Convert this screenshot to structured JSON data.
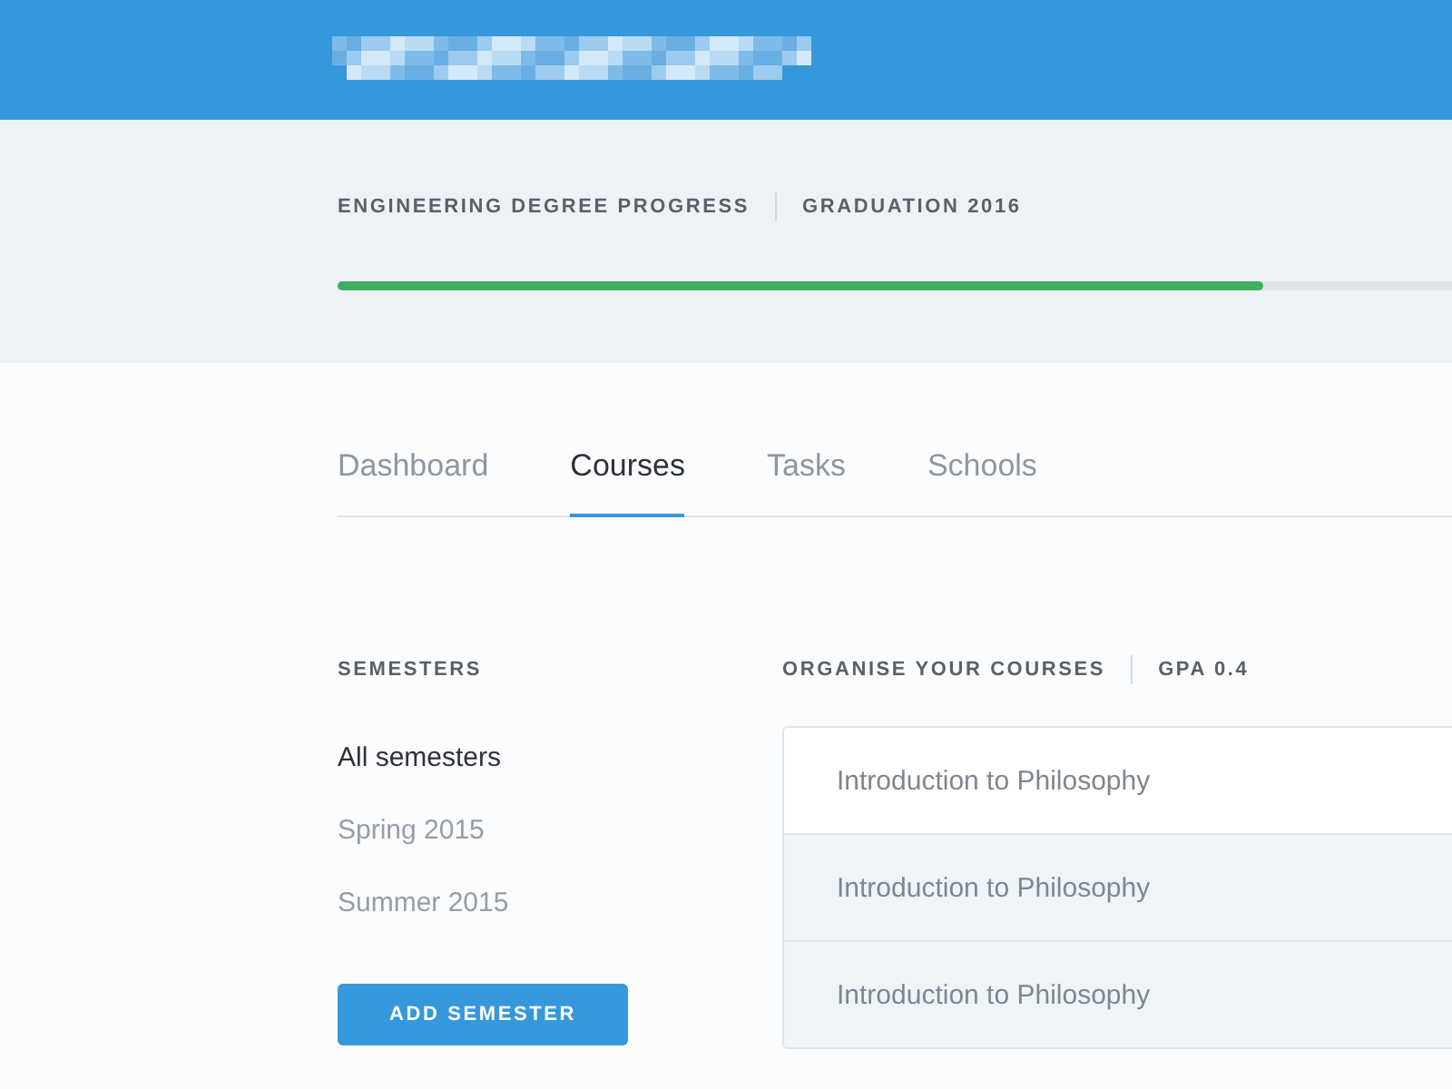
{
  "progress": {
    "title": "ENGINEERING DEGREE PROGRESS",
    "graduation": "GRADUATION 2016",
    "level": 0.83
  },
  "tabs": [
    {
      "label": "Dashboard",
      "selected": false
    },
    {
      "label": "Courses",
      "selected": true
    },
    {
      "label": "Tasks",
      "selected": false
    },
    {
      "label": "Schools",
      "selected": false
    }
  ],
  "semesters": {
    "heading": "SEMESTERS",
    "items": [
      {
        "label": "All semesters",
        "selected": true
      },
      {
        "label": "Spring 2015",
        "selected": false
      },
      {
        "label": "Summer 2015",
        "selected": false
      }
    ],
    "button": "ADD SEMESTER"
  },
  "courses": {
    "heading": "ORGANISE YOUR COURSES",
    "gpa": "GPA 0.4",
    "rows": [
      {
        "name": "Introduction to Philosophy",
        "selected": true
      },
      {
        "name": "Introduction to Philosophy",
        "selected": false
      },
      {
        "name": "Introduction to Philosophy",
        "selected": false
      }
    ]
  }
}
